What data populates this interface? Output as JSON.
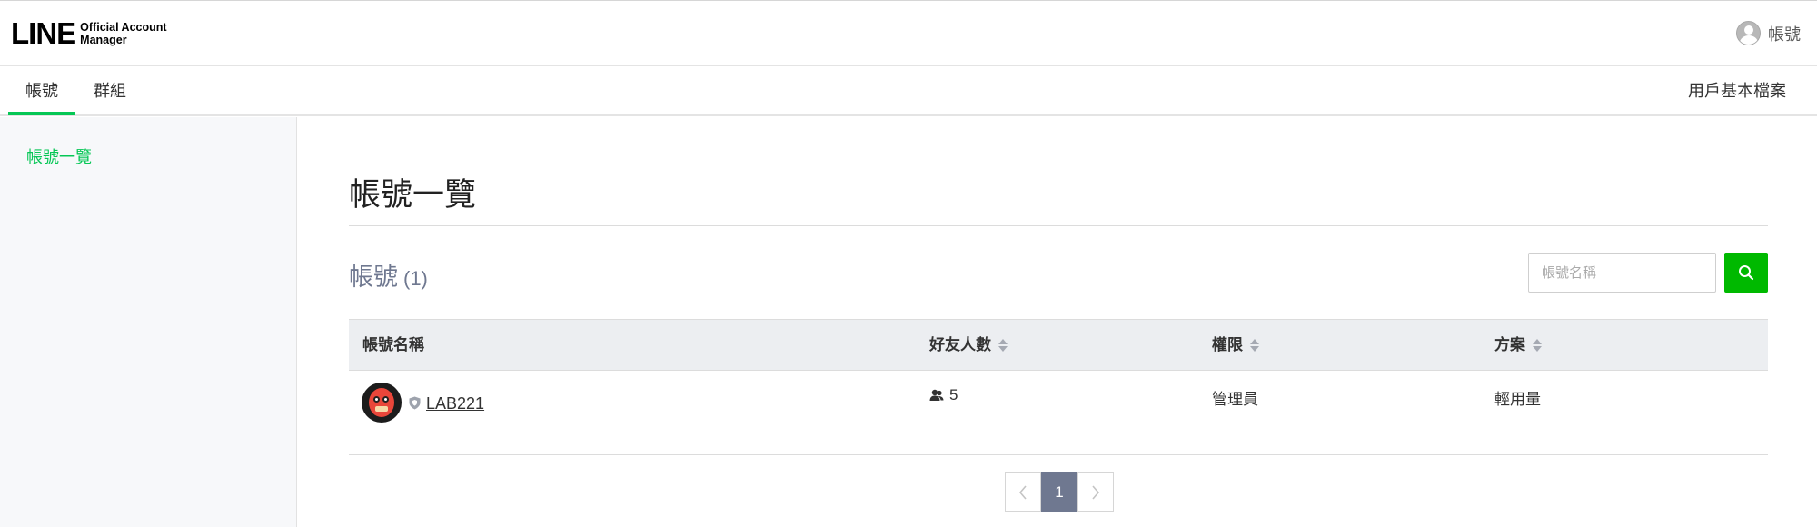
{
  "header": {
    "logo_text": "LINE",
    "logo_subtitle_line1": "Official Account",
    "logo_subtitle_line2": "Manager",
    "user_label": "帳號"
  },
  "tabs": [
    {
      "label": "帳號",
      "active": true
    },
    {
      "label": "群組",
      "active": false
    }
  ],
  "tab_profile_label": "用戶基本檔案",
  "sidebar": {
    "items": [
      {
        "label": "帳號一覽",
        "active": true
      }
    ]
  },
  "main": {
    "page_title": "帳號一覽",
    "section_title": "帳號",
    "section_count": "(1)",
    "search": {
      "placeholder": "帳號名稱",
      "value": ""
    },
    "table": {
      "headers": [
        "帳號名稱",
        "好友人數",
        "權限",
        "方案"
      ],
      "rows": [
        {
          "name": "LAB221",
          "friends": "5",
          "role": "管理員",
          "plan": "輕用量"
        }
      ]
    },
    "pagination": {
      "current_page": "1"
    }
  },
  "colors": {
    "accent_green": "#06c755",
    "search_button": "#00b900",
    "muted_title": "#6f7890"
  },
  "icons": [
    "user-avatar-icon",
    "search-icon",
    "sort-icon",
    "shield-icon",
    "friends-icon",
    "chevron-left-icon",
    "chevron-right-icon"
  ]
}
